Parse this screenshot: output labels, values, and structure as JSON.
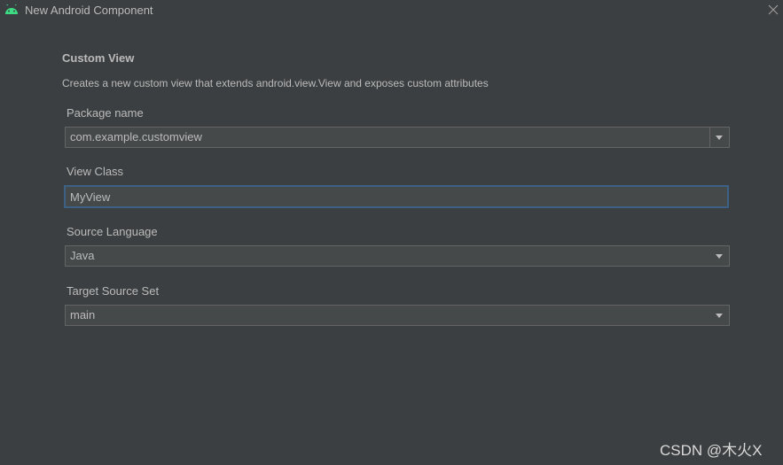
{
  "window": {
    "title": "New Android Component",
    "icon": "android-icon",
    "close_icon": "close-icon"
  },
  "header": {
    "title": "Custom View",
    "description": "Creates a new custom view that extends android.view.View and exposes custom attributes"
  },
  "form": {
    "package_name": {
      "label": "Package name",
      "value": "com.example.customview"
    },
    "view_class": {
      "label": "View Class",
      "value": "MyView"
    },
    "source_language": {
      "label": "Source Language",
      "value": "Java"
    },
    "target_source_set": {
      "label": "Target Source Set",
      "value": "main"
    }
  },
  "watermark": "CSDN @木火X",
  "colors": {
    "background": "#3c3f41",
    "field_background": "#45494a",
    "field_border": "#646464",
    "focus_border": "#3d6185",
    "text": "#bbbbbb",
    "android_green": "#3ddc84"
  }
}
